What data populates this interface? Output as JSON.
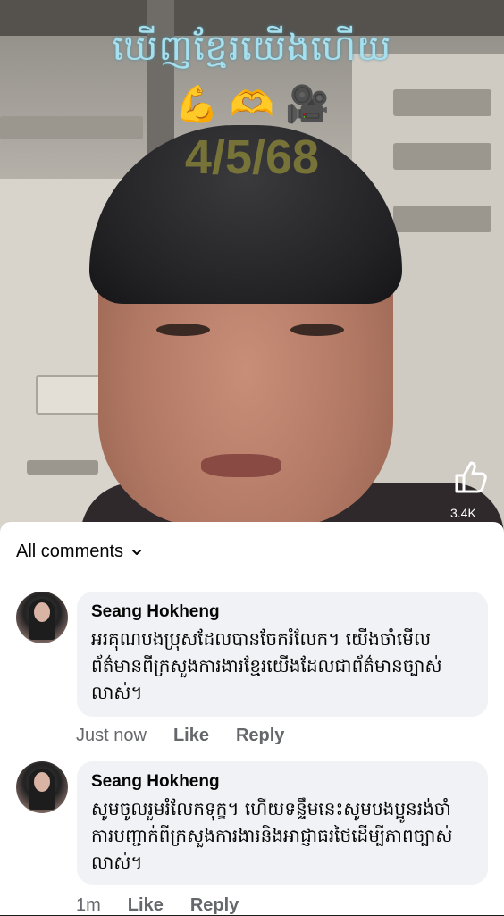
{
  "video": {
    "overlay_title": "ឃើញខ្មែរយើងហើយ",
    "emojis": [
      "💪",
      "🫶",
      "🎥"
    ],
    "overlay_date": "4/5/68",
    "like_count": "3.4K"
  },
  "comments_sheet": {
    "sort_label": "All comments",
    "comments": [
      {
        "author": "Seang Hokheng",
        "text": "អរគុណបងប្រុសដែលបានចែករំលែក។ យើងចាំមើលព័ត៌មានពីក្រសួងការងារខ្មែរយើងដែលជាព័ត៌មានច្បាស់លាស់។",
        "time": "Just now",
        "like_label": "Like",
        "reply_label": "Reply"
      },
      {
        "author": "Seang Hokheng",
        "text": "សូមចូលរួមរំលែកទុក្ខ។ ហើយទន្ទឹមនេះសូមបងប្អូនរង់ចាំការបញ្ជាក់ពីក្រសួងការងារនិងអាជ្ញាធរថៃដើម្បីភាពច្បាស់លាស់។",
        "time": "1m",
        "like_label": "Like",
        "reply_label": "Reply"
      }
    ]
  }
}
